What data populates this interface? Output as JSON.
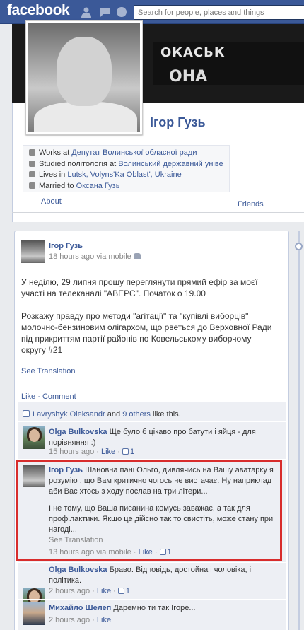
{
  "topbar": {
    "logo": "facebook",
    "search_placeholder": "Search for people, places and things"
  },
  "profile": {
    "cover_text_1": "ОКАСЬК",
    "cover_text_2": "ОНА",
    "name": "Ігор Гузь",
    "info": [
      {
        "icon": "briefcase-icon",
        "prefix": "Works at ",
        "link": "Депутат Волинської обласної ради"
      },
      {
        "icon": "graduation-cap-icon",
        "prefix": "Studied політологія at ",
        "link": "Волинський державний універ..."
      },
      {
        "icon": "house-icon",
        "prefix": "Lives in ",
        "link": "Lutsk, Volyns'Ka Oblast', Ukraine"
      },
      {
        "icon": "heart-icon",
        "prefix": "Married to ",
        "link": "Оксана Гузь"
      }
    ],
    "about_label": "About",
    "friends_label": "Friends"
  },
  "post": {
    "author": "Ігор Гузь",
    "meta": "18 hours ago via mobile",
    "paragraph_1": "У неділю, 29 липня прошу переглянути прямий ефір за моєї участі на телеканалі \"АВЕРС\". Початок о 19.00",
    "paragraph_2": "Розкажу правду про методи \"агітації\" та \"купівлі виборців\" молочно-бензиновим олігархом, що рветься до Верховної Ради під прикриттям партії районів по Ковельському виборчому округу #21",
    "see_translation": "See Translation",
    "like_label": "Like",
    "comment_label": "Comment",
    "likes": {
      "person": "Lavryshyk Oleksandr",
      "and": " and ",
      "others": "9 others",
      "suffix": " like this."
    }
  },
  "comments": [
    {
      "author": "Olga Bulkovska",
      "text": " Ще було б цікаво про батути і яйця - для порівняння :)",
      "time": "15 hours ago",
      "like": "Like",
      "likes": "1"
    },
    {
      "author": "Ігор Гузь",
      "text_1": " Шановна пані Ольго, дивлячись на Вашу аватарку я розумію , що Вам критично чогось не вистачає. Ну наприклад аби Вас хтось з ходу послав на три літери...",
      "text_2": "І не тому, що Ваша писанина комусь заважає, а так для профілактики. Якщо це дійсно так то свистіть, може стану при нагоді...",
      "see_translation": "See Translation",
      "time": "13 hours ago via mobile",
      "like": "Like",
      "likes": "1"
    },
    {
      "author": "Olga Bulkovska",
      "text": " Браво. Відповідь, достойна і чоловіка, і політика.",
      "time": "2 hours ago",
      "like": "Like",
      "likes": "1"
    },
    {
      "author": "Михайло Шелеп",
      "text": " Даремно ти так Ігоре...",
      "time": "2 hours ago",
      "like": "Like"
    }
  ],
  "dot": " · "
}
